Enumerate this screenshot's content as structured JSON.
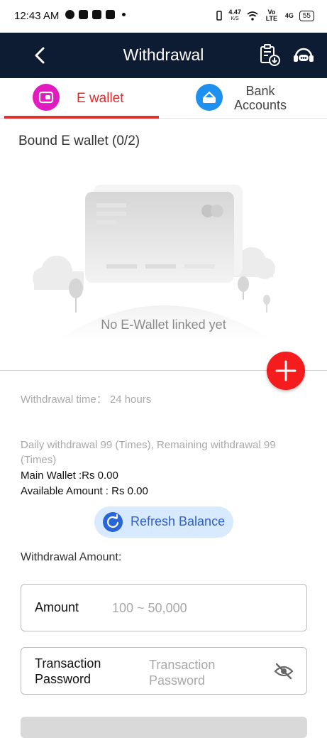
{
  "status_bar": {
    "time": "12:43 AM",
    "net_speed_value": "4.47",
    "net_speed_unit": "K/S",
    "net_type": "Vo LTE",
    "signal": "4G",
    "battery": "55"
  },
  "header": {
    "title": "Withdrawal",
    "back_icon": "chevron-left-icon",
    "record_icon": "clipboard-download-icon",
    "support_icon": "customer-service-icon"
  },
  "tabs": [
    {
      "label": "E wallet",
      "icon": "wallet-icon",
      "active": true
    },
    {
      "label_lines": [
        "Bank",
        "Accounts"
      ],
      "icon": "bank-card-icon",
      "active": false
    }
  ],
  "bound": {
    "title": "Bound E wallet (0/2)",
    "empty_text": "No E-Wallet linked yet"
  },
  "info": {
    "withdrawal_time": "Withdrawal time：  24 hours",
    "daily_limit": "Daily withdrawal 99 (Times), Remaining withdrawal 99 (Times)",
    "main_wallet": "Main Wallet :Rs 0.00",
    "available_amount": "Available Amount : Rs 0.00"
  },
  "refresh": {
    "label": "Refresh Balance",
    "icon": "refresh-icon"
  },
  "form": {
    "section_label": "Withdrawal Amount:",
    "amount_label": "Amount",
    "amount_placeholder": "100 ~ 50,000",
    "password_label_lines": [
      "Transaction",
      "Password"
    ],
    "password_placeholder_lines": [
      "Transaction",
      "Password"
    ],
    "password_placeholder": "Transaction Password",
    "eye_icon": "eye-off-icon"
  },
  "colors": {
    "header_bg": "#0e1c33",
    "accent_red": "#e0312f",
    "add_button": "#f41c1c",
    "refresh_bg": "#d8eaff",
    "refresh_text": "#2f5fc7",
    "ewallet_icon_bg": "#e11bbf",
    "bank_icon_bg": "#1e90f0"
  }
}
